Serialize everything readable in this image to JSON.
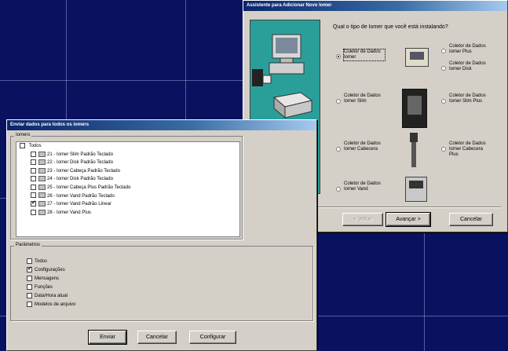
{
  "wizard": {
    "title": "Assistente para Adicionar Novo Iomer",
    "question": "Qual o tipo de Iomer que você está instalando?",
    "options": [
      {
        "label": "Coletor de Dados Iomer",
        "selected": true
      },
      {
        "label": "Coletor de Dados Iomer Plus",
        "selected": false
      },
      {
        "label": "Coletor de Dados Iomer Slim",
        "selected": false
      },
      {
        "label": "Coletor de Dados Iomer Slim Plus",
        "selected": false
      },
      {
        "label": "Coletor de Dados Iomer Cabecera",
        "selected": false
      },
      {
        "label": "Coletor de Dados Iomer Cabecera Plus",
        "selected": false
      },
      {
        "label": "Coletor de Dados Iomer Vand",
        "selected": false
      }
    ],
    "extra_option": "Coletor de Dados Iomer Disk",
    "buttons": {
      "back": "< Voltar",
      "next": "Avançar >",
      "cancel": "Cancelar"
    }
  },
  "send": {
    "title": "Enviar dados para todos os iomers",
    "group_label": "Iomers",
    "root_label": "Todos",
    "items": [
      {
        "label": "21 - Iomer Slim Padrão Teclado",
        "checked": false
      },
      {
        "label": "22 - Iomer Disk Padrão Teclado",
        "checked": false
      },
      {
        "label": "23 - Iomer Cabeça Padrão Teclado",
        "checked": false
      },
      {
        "label": "24 - Iomer Disk Padrão Teclado",
        "checked": false
      },
      {
        "label": "25 - Iomer Cabeça Plus Padrão Teclado",
        "checked": false
      },
      {
        "label": "26 - Iomer Vand Padrão Teclado",
        "checked": false
      },
      {
        "label": "27 - Iomer Vand Padrão Linear",
        "checked": true
      },
      {
        "label": "28 - Iomer Vand Plus",
        "checked": false
      }
    ],
    "params_label": "Parâmetros",
    "params": [
      {
        "label": "Todos",
        "checked": false
      },
      {
        "label": "Configurações",
        "checked": true
      },
      {
        "label": "Mensagens",
        "checked": false
      },
      {
        "label": "Funções",
        "checked": false
      },
      {
        "label": "Data/Hora atual",
        "checked": false
      },
      {
        "label": "Modelos de arquivo",
        "checked": false
      }
    ],
    "buttons": {
      "send": "Enviar",
      "cancel": "Cancelar",
      "configure": "Configurar"
    }
  }
}
